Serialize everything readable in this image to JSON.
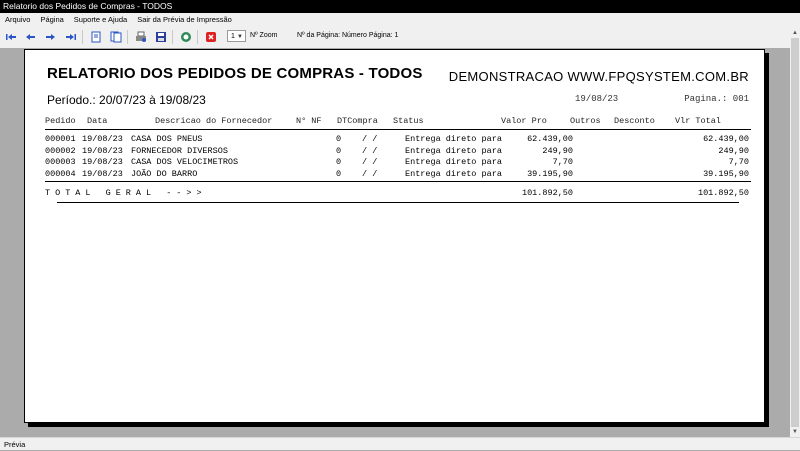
{
  "window": {
    "title": "Relatorio dos Pedidos de Compras - TODOS"
  },
  "menu": [
    "Arquivo",
    "Página",
    "Suporte e Ajuda",
    "Sair da Prévia de Impressão"
  ],
  "toolbar": {
    "zoom_value": "1",
    "zoom_label": "Nº Zoom",
    "page_label": "Nº da Página: Número Página: 1",
    "icons": [
      "first-page-icon",
      "previous-page-icon",
      "next-page-icon",
      "last-page-icon",
      "single-page-icon",
      "two-pages-icon",
      "print-setup-icon",
      "save-icon",
      "export-icon",
      "close-icon"
    ]
  },
  "report": {
    "title": "RELATORIO DOS PEDIDOS DE COMPRAS - TODOS",
    "company": "DEMONSTRACAO WWW.FPQSYSTEM.COM.BR",
    "period": "Período.: 20/07/23 à 19/08/23",
    "print_date": "19/08/23",
    "page": "Pagina.: 001",
    "columns": {
      "pedido": "Pedido",
      "data": "Data",
      "fornecedor": "Descricao do Fornecedor",
      "nf": "N° NF",
      "dtcompra": "DTCompra",
      "status": "Status",
      "valor_pro": "Valor Pro",
      "outros": "Outros",
      "desconto": "Desconto",
      "vlr_total": "Vlr Total"
    },
    "rows": [
      {
        "pedido": "000001",
        "data": "19/08/23",
        "fornecedor": "CASA DOS PNEUS",
        "nf": "0",
        "dtcompra": "/  /",
        "status": "Entrega direto para",
        "valor_pro": "62.439,00",
        "vlr_total": "62.439,00"
      },
      {
        "pedido": "000002",
        "data": "19/08/23",
        "fornecedor": "FORNECEDOR DIVERSOS",
        "nf": "0",
        "dtcompra": "/  /",
        "status": "Entrega direto para",
        "valor_pro": "249,90",
        "vlr_total": "249,90"
      },
      {
        "pedido": "000003",
        "data": "19/08/23",
        "fornecedor": "CASA DOS VELOCIMETROS",
        "nf": "0",
        "dtcompra": "/  /",
        "status": "Entrega direto para",
        "valor_pro": "7,70",
        "vlr_total": "7,70"
      },
      {
        "pedido": "000004",
        "data": "19/08/23",
        "fornecedor": "JOÃO DO BARRO",
        "nf": "0",
        "dtcompra": "/  /",
        "status": "Entrega direto para",
        "valor_pro": "39.195,90",
        "vlr_total": "39.195,90"
      }
    ],
    "total_label": "TOTAL GERAL -->>",
    "total_valor_pro": "101.892,50",
    "total_vlr_total": "101.892,50"
  },
  "status_bar": {
    "text": "Prévia"
  }
}
